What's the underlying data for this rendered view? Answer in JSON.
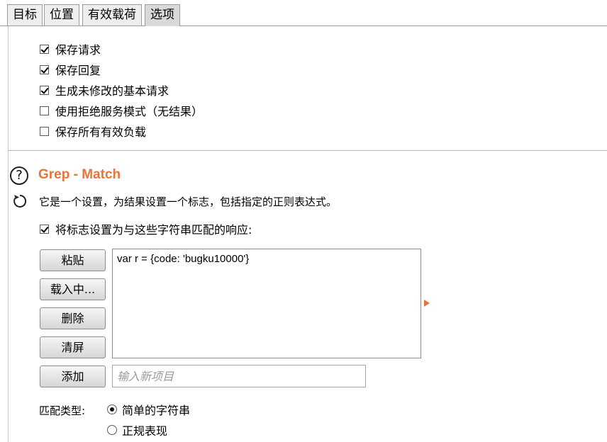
{
  "tabs": [
    {
      "label": "目标",
      "selected": false
    },
    {
      "label": "位置",
      "selected": false
    },
    {
      "label": "有效载荷",
      "selected": false
    },
    {
      "label": "选项",
      "selected": true
    }
  ],
  "options": [
    {
      "label": "保存请求",
      "checked": true
    },
    {
      "label": "保存回复",
      "checked": true
    },
    {
      "label": "生成未修改的基本请求",
      "checked": true
    },
    {
      "label": "使用拒绝服务模式（无结果）",
      "checked": false
    },
    {
      "label": "保存所有有效负载",
      "checked": false
    }
  ],
  "grep_match": {
    "title": "Grep - Match",
    "description": "它是一个设置，为结果设置一个标志，包括指定的正则表达式。",
    "flag_checkbox": {
      "label": "将标志设置为与这些字符串匹配的响应:",
      "checked": true
    },
    "buttons": {
      "paste": "粘贴",
      "load": "载入中...",
      "remove": "删除",
      "clear": "清屏",
      "add": "添加"
    },
    "items": [
      "var r = {code: 'bugku10000'}"
    ],
    "new_item_placeholder": "输入新项目",
    "match_type_label": "匹配类型:",
    "match_types": [
      {
        "label": "简单的字符串",
        "selected": true
      },
      {
        "label": "正规表现",
        "selected": false
      }
    ]
  },
  "colors": {
    "accent": "#e8743b"
  },
  "icons": {
    "help": "help-icon",
    "refresh": "refresh-icon",
    "expand": "expand-arrow-icon"
  }
}
